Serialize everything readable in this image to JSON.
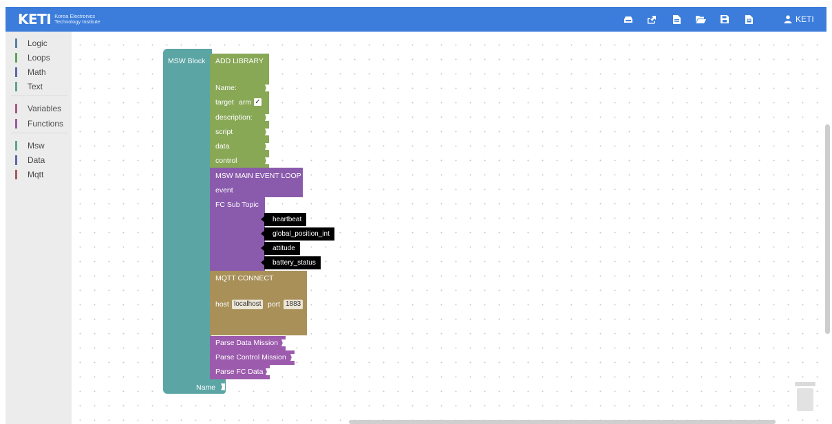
{
  "header": {
    "logo_main": "KETI",
    "logo_line1": "Korea Electronics",
    "logo_line2": "Technology Institute",
    "user_name": "KETI",
    "toolbar_icons": [
      "upload-cloud-icon",
      "share-export-icon",
      "file-icon",
      "folder-open-icon",
      "save-icon",
      "file-save-icon"
    ]
  },
  "sidebar": {
    "categories": [
      {
        "label": "Logic",
        "color": "#5b80a5"
      },
      {
        "label": "Loops",
        "color": "#5ba55b"
      },
      {
        "label": "Math",
        "color": "#5b67a5"
      },
      {
        "label": "Text",
        "color": "#5ba58c"
      },
      {
        "label": "Variables",
        "color": "#a55b80"
      },
      {
        "label": "Functions",
        "color": "#995ba5"
      },
      {
        "label": "Msw",
        "color": "#5ba58c"
      },
      {
        "label": "Data",
        "color": "#5b67a5"
      },
      {
        "label": "Mqtt",
        "color": "#a55b5b"
      }
    ]
  },
  "workspace": {
    "msw_block": {
      "label": "MSW Block",
      "name_label": "Name",
      "color": "#5ba5a5"
    },
    "add_library": {
      "title": "ADD LIBRARY",
      "name_label": "Name:",
      "target_label": "target",
      "target_value": "arm",
      "target_checked": true,
      "description_label": "description:",
      "script_label": "script",
      "data_label": "data",
      "control_label": "control",
      "color": "#88a856"
    },
    "main_loop": {
      "title": "MSW MAIN EVENT LOOP",
      "event_label": "event",
      "fc_sub_topic_label": "FC Sub Topic",
      "topics": [
        "heartbeat",
        "global_position_int",
        "attitude",
        "battery_status"
      ],
      "color": "#8a5bad"
    },
    "mqtt_connect": {
      "title": "MQTT CONNECT",
      "host_label": "host",
      "host_value": "localhost",
      "port_label": "port",
      "port_value": "1883",
      "color": "#a89058"
    },
    "parse_blocks": [
      "Parse Data Mission",
      "Parse Control Mission",
      "Parse FC Data"
    ],
    "parse_color": "#9c5bad"
  }
}
